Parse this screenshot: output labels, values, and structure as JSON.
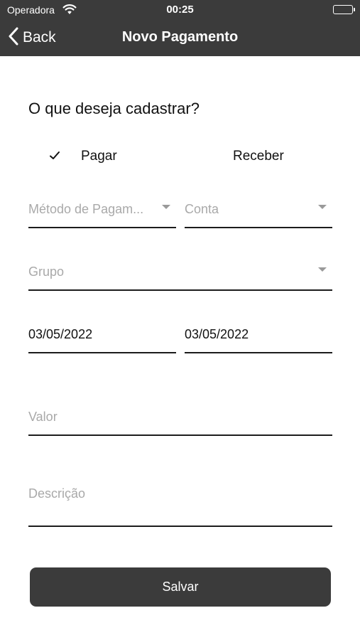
{
  "status_bar": {
    "carrier": "Operadora",
    "time": "00:25",
    "wifi_icon": "wifi-icon",
    "battery_icon": "battery-icon",
    "battery_level": 1.0
  },
  "nav": {
    "back_label": "Back",
    "back_icon": "chevron-left-icon",
    "title": "Novo Pagamento"
  },
  "form": {
    "question": "O que deseja cadastrar?",
    "type_options": [
      {
        "label": "Pagar",
        "selected": true,
        "icon": "checkmark-icon"
      },
      {
        "label": "Receber",
        "selected": false
      }
    ],
    "metodo_pagamento": {
      "placeholder": "Método de Pagam...",
      "icon": "dropdown-arrow-icon"
    },
    "conta": {
      "placeholder": "Conta",
      "icon": "dropdown-arrow-icon"
    },
    "grupo": {
      "placeholder": "Grupo",
      "icon": "dropdown-arrow-icon"
    },
    "date_1": {
      "value": "03/05/2022"
    },
    "date_2": {
      "value": "03/05/2022"
    },
    "valor": {
      "placeholder": "Valor"
    },
    "descricao": {
      "placeholder": "Descrição"
    },
    "save_label": "Salvar"
  },
  "colors": {
    "header_bg": "#3b3b3b",
    "button_bg": "#3b3b3b",
    "placeholder_text": "#a9a9a9",
    "underline": "#1c1c1c"
  }
}
